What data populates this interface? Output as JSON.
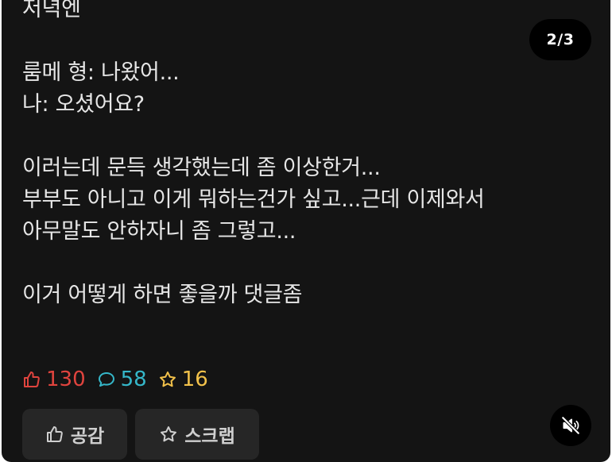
{
  "post": {
    "lines": [
      "저녁엔",
      "",
      "룸메 형: 나왔어...",
      "나: 오셨어요?",
      "",
      "이러는데 문득 생각했는데 좀 이상한거...",
      "부부도 아니고 이게 뭐하는건가 싶고...근데 이제와서",
      "아무말도 안하자니 좀 그렇고...",
      "",
      "이거 어떻게 하면 좋을까 댓글좀"
    ]
  },
  "pager": {
    "label": "2/3"
  },
  "stats": {
    "likes": "130",
    "comments": "58",
    "scraps": "16"
  },
  "actions": {
    "like_label": "공감",
    "scrap_label": "스크랩"
  },
  "icons": {
    "like": "thumbs-up-icon",
    "comment": "speech-bubble-icon",
    "scrap": "star-icon",
    "mute": "speaker-muted-icon"
  },
  "colors": {
    "background": "#141414",
    "text": "#e6e6e6",
    "like": "#e0443e",
    "comment": "#35b7c9",
    "scrap": "#f2c14a",
    "button_bg": "#262626"
  }
}
